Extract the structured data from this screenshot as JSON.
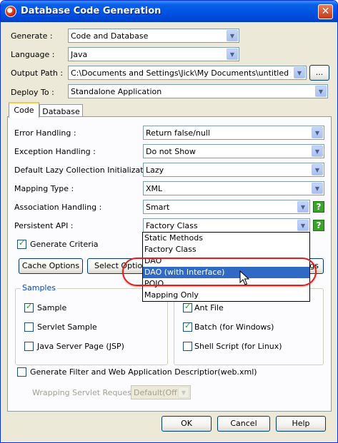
{
  "window": {
    "title": "Database Code Generation",
    "close_glyph": "✕"
  },
  "form": {
    "generate": {
      "label": "Generate :",
      "value": "Code and Database"
    },
    "language": {
      "label": "Language :",
      "value": "Java"
    },
    "output_path": {
      "label": "Output Path :",
      "value": "C:\\Documents and Settings\\Jick\\My Documents\\untitled",
      "browse_label": "..."
    },
    "deploy_to": {
      "label": "Deploy To :",
      "value": "Standalone Application"
    }
  },
  "tabs": [
    {
      "label": "Code",
      "active": true
    },
    {
      "label": "Database",
      "active": false
    }
  ],
  "code_tab": {
    "error_handling": {
      "label": "Error Handling :",
      "value": "Return false/null"
    },
    "exception_handling": {
      "label": "Exception Handling :",
      "value": "Do not Show"
    },
    "lazy_collection": {
      "label": "Default Lazy Collection Initialization :",
      "value": "Lazy"
    },
    "mapping_type": {
      "label": "Mapping Type :",
      "value": "XML"
    },
    "association_handling": {
      "label": "Association Handling :",
      "value": "Smart"
    },
    "persistent_api": {
      "label": "Persistent API :",
      "value": "Factory Class"
    },
    "generate_criteria": {
      "label": "Generate Criteria",
      "checked": true
    },
    "buttons": {
      "cache_options": "Cache Options",
      "select_optional": "Select Optiona",
      "settings_partial": "gs"
    },
    "persistent_api_options": [
      "Static Methods",
      "Factory Class",
      "DAO",
      "DAO (with Interface)",
      "POJO",
      "Mapping Only"
    ],
    "persistent_api_highlighted": "DAO (with Interface)",
    "samples": {
      "title": "Samples",
      "sample": {
        "label": "Sample",
        "checked": true
      },
      "servlet_sample": {
        "label": "Servlet Sample",
        "checked": false
      },
      "jsp": {
        "label": "Java Server Page (JSP)",
        "checked": false
      }
    },
    "scripts": {
      "ant_file": {
        "label": "Ant File",
        "checked": true
      },
      "batch": {
        "label": "Batch (for Windows)",
        "checked": true
      },
      "shell": {
        "label": "Shell Script (for Linux)",
        "checked": false
      }
    },
    "generate_filter": {
      "label": "Generate Filter and Web Application Descriptior(web.xml)",
      "checked": false
    },
    "wrapping_servlet": {
      "label": "Wrapping Servlet Request :",
      "value": "Default(Off)"
    }
  },
  "footer": {
    "ok": "OK",
    "cancel": "Cancel",
    "help": "Help"
  },
  "help_glyph": "?",
  "colors": {
    "title_bar": "#0055e5",
    "selection": "#316ac5",
    "highlight_ring": "#e0211b",
    "help_icon": "#3ca32a"
  }
}
